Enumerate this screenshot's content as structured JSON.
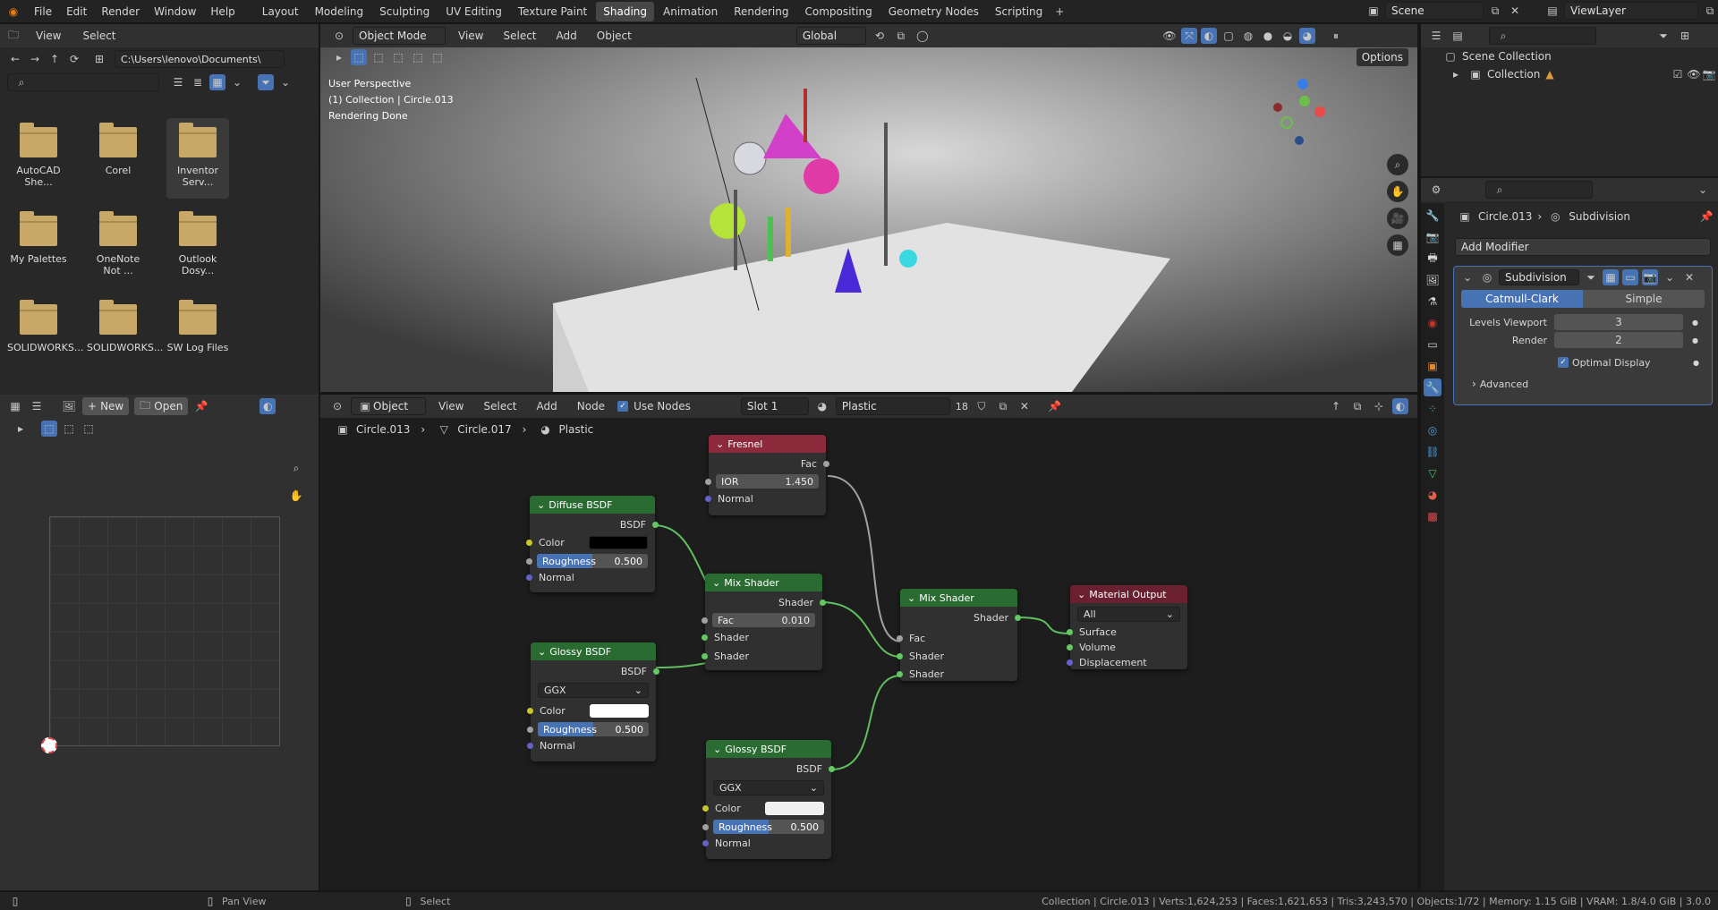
{
  "topbar": {
    "menus": [
      "File",
      "Edit",
      "Render",
      "Window",
      "Help"
    ],
    "workspaces": [
      "Layout",
      "Modeling",
      "Sculpting",
      "UV Editing",
      "Texture Paint",
      "Shading",
      "Animation",
      "Rendering",
      "Compositing",
      "Geometry Nodes",
      "Scripting"
    ],
    "active_workspace": "Shading",
    "scene": "Scene",
    "view_layer": "ViewLayer"
  },
  "filebrowser": {
    "menus": [
      "View",
      "Select"
    ],
    "path": "C:\\Users\\lenovo\\Documents\\",
    "folders": [
      "AutoCAD She...",
      "Corel",
      "Inventor Serv...",
      "My Palettes",
      "OneNote Not ...",
      "Outlook Dosy...",
      "SOLIDWORKS...",
      "SOLIDWORKS...",
      "SW Log Files"
    ]
  },
  "viewport": {
    "mode": "Object Mode",
    "menus": [
      "View",
      "Select",
      "Add",
      "Object"
    ],
    "transform": "Global",
    "options": "Options",
    "info": [
      "User Perspective",
      "(1) Collection | Circle.013",
      "Rendering Done"
    ]
  },
  "outliner": {
    "scene_collection": "Scene Collection",
    "collection": "Collection"
  },
  "properties": {
    "breadcrumb_obj": "Circle.013",
    "breadcrumb_mod": "Subdivision",
    "add_modifier": "Add Modifier",
    "modifier_name": "Subdivision",
    "tab_catmull": "Catmull-Clark",
    "tab_simple": "Simple",
    "levels_label": "Levels Viewport",
    "levels_value": "3",
    "render_label": "Render",
    "render_value": "2",
    "optimal": "Optimal Display",
    "advanced": "Advanced"
  },
  "image_editor": {
    "new": "New",
    "open": "Open"
  },
  "node_editor": {
    "object": "Object",
    "menus": [
      "View",
      "Select",
      "Add",
      "Node"
    ],
    "use_nodes": "Use Nodes",
    "slot": "Slot 1",
    "material": "Plastic",
    "users": "18",
    "bc_obj": "Circle.013",
    "bc_mesh": "Circle.017",
    "bc_mat": "Plastic"
  },
  "nodes": {
    "fresnel": {
      "title": "Fresnel",
      "out": "Fac",
      "ior_label": "IOR",
      "ior": "1.450",
      "normal": "Normal"
    },
    "diffuse": {
      "title": "Diffuse BSDF",
      "out": "BSDF",
      "color": "Color",
      "rough_label": "Roughness",
      "rough": "0.500",
      "normal": "Normal",
      "color_hex": "#000000",
      "rough_fill": 0.5
    },
    "glossy1": {
      "title": "Glossy BSDF",
      "out": "BSDF",
      "dist": "GGX",
      "color": "Color",
      "rough_label": "Roughness",
      "rough": "0.500",
      "normal": "Normal",
      "color_hex": "#ffffff"
    },
    "mix1": {
      "title": "Mix Shader",
      "out": "Shader",
      "fac_label": "Fac",
      "fac": "0.010",
      "s1": "Shader",
      "s2": "Shader"
    },
    "mix2": {
      "title": "Mix Shader",
      "out": "Shader",
      "fac": "Fac",
      "s1": "Shader",
      "s2": "Shader"
    },
    "glossy2": {
      "title": "Glossy BSDF",
      "out": "BSDF",
      "dist": "GGX",
      "color": "Color",
      "rough_label": "Roughness",
      "rough": "0.500",
      "normal": "Normal",
      "color_hex": "#f0f0f0"
    },
    "output": {
      "title": "Material Output",
      "target": "All",
      "surface": "Surface",
      "volume": "Volume",
      "displacement": "Displacement"
    }
  },
  "statusbar": {
    "pan": "Pan View",
    "select": "Select",
    "stats": "Collection | Circle.013 | Verts:1,624,253 | Faces:1,621,653 | Tris:3,243,570 | Objects:1/72 | Memory: 1.15 GiB | VRAM: 1.8/4.0 GiB | 3.0.0"
  }
}
